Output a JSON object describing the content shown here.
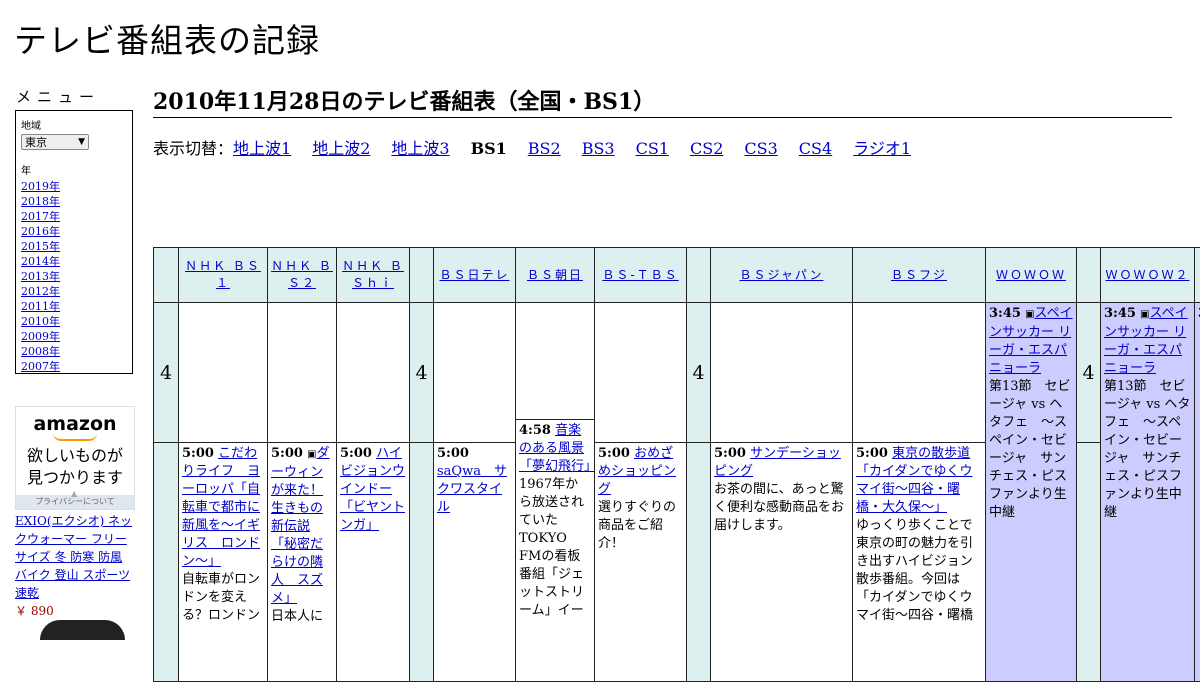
{
  "site_title": "テレビ番組表の記録",
  "menu": {
    "label": "メニュー",
    "region_label": "地域",
    "region_value": "東京",
    "year_label": "年",
    "years": [
      "2019年",
      "2018年",
      "2017年",
      "2016年",
      "2015年",
      "2014年",
      "2013年",
      "2012年",
      "2011年",
      "2010年",
      "2009年",
      "2008年",
      "2007年"
    ]
  },
  "ad": {
    "logo": "amazon",
    "copy1": "欲しいものが",
    "copy2": "見つかります",
    "privacy": "プライバシーについて",
    "product_name": "EXIO(エクシオ) ネックウォーマー フリーサイズ 冬 防寒 防風 バイク 登山 スポーツ 速乾",
    "product_price": "￥ 890"
  },
  "page_title": "2010年11月28日のテレビ番組表（全国・BS1）",
  "switcher": {
    "prefix": "表示切替：",
    "items": [
      "地上波1",
      "地上波2",
      "地上波3",
      "BS1",
      "BS2",
      "BS3",
      "CS1",
      "CS2",
      "CS3",
      "CS4",
      "ラジオ1"
    ],
    "current": "BS1"
  },
  "time_label": "4",
  "channels": {
    "nhk_bs1": "ＮＨＫ ＢＳ１",
    "nhk_bs2": "ＮＨＫ ＢＳ２",
    "nhk_bshi": "ＮＨＫ ＢＳｈｉ",
    "bs_nittele": "ＢＳ日テレ",
    "bs_asahi": "ＢＳ朝日",
    "bs_tbs": "ＢＳ-ＴＢＳ",
    "bs_japan": "ＢＳジャパン",
    "bs_fuji": "ＢＳフジ",
    "wowow": "ＷＯＷＯＷ",
    "wowow2": "ＷＯＷＯＷ２"
  },
  "programs": {
    "bs1_500": {
      "time": "5:00",
      "title": "こだわりライフ　ヨーロッパ「自転車で都市に新風を～イギリス　ロンドン～」",
      "desc": "自転車がロンドンを変える？ロンドン"
    },
    "bs2_500": {
      "time": "5:00",
      "icon": "data-broadcast-icon",
      "title": "ダーウィンが来た！生きもの新伝説「秘密だらけの隣人　スズメ」",
      "desc": "日本人に"
    },
    "bshi_500": {
      "time": "5:00",
      "title": "ハイビジョンウインドー「ビヤントンガ」"
    },
    "nittele_500": {
      "time": "5:00",
      "title": "saQwa　サクワスタイル"
    },
    "asahi_458": {
      "time": "4:58",
      "title": "音楽のある風景「夢幻飛行」",
      "desc": "1967年から放送されていたTOKYO FMの看板番組「ジェットストリーム」イー"
    },
    "tbs_500": {
      "time": "5:00",
      "title": "おめざめショッピング",
      "desc": "選りすぐりの商品をご紹介！"
    },
    "japan_500": {
      "time": "5:00",
      "title": "サンデーショッピング",
      "desc": "お茶の間に、あっと驚く便利な感動商品をお届けします。"
    },
    "fuji_500": {
      "time": "5:00",
      "title": "東京の散歩道「カイダンでゆくウマイ街～四谷・曙橋・大久保～」",
      "desc": "ゆっくり歩くことで東京の町の魅力を引き出すハイビジョン散歩番組。今回は「カイダンでゆくウマイ街～四谷・曙橋"
    },
    "wowow_345": {
      "time": "3:45",
      "icon": "data-broadcast-icon",
      "title": "スペインサッカー リーガ・エスパニョーラ",
      "desc": "第13節　セビージャ vs ヘタフェ　～スペイン・セビージャ　サンチェス・ピスファンより生中継"
    },
    "wowow2_345": {
      "time": "3:45",
      "icon": "data-broadcast-icon",
      "title": "スペインサッカー リーガ・エスパニョーラ",
      "desc": "第13節　セビージャ vs ヘタフェ　～スペイン・セビージャ　サンチェス・ピスファンより生中継"
    },
    "partial_next": {
      "time": "3"
    }
  }
}
